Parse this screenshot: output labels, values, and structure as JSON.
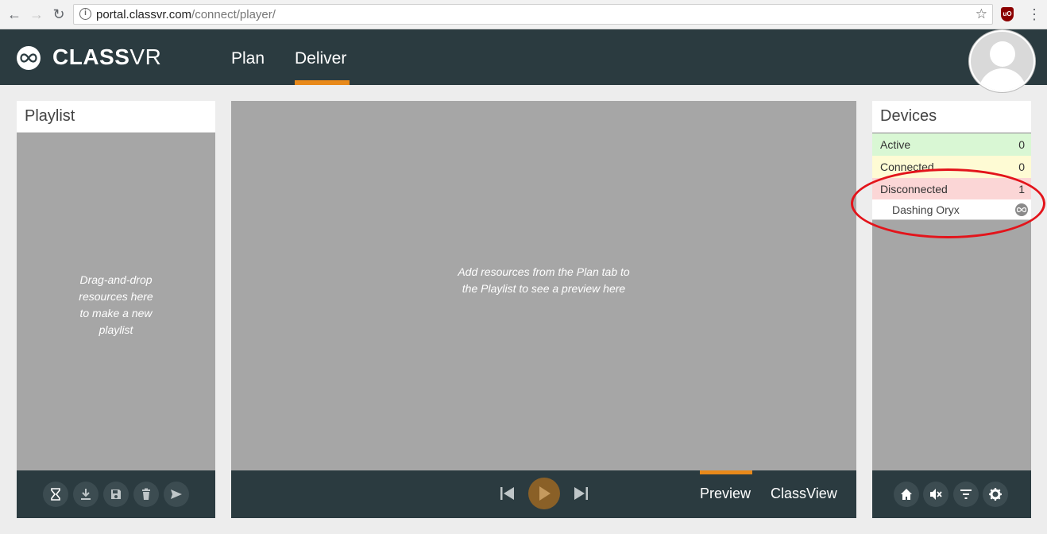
{
  "browser": {
    "url_host": "portal.classvr.com",
    "url_path": "/connect/player/",
    "back_icon": "arrow-left-icon",
    "forward_icon": "arrow-right-icon",
    "reload_icon": "reload-icon",
    "ext_label": "uO"
  },
  "header": {
    "brand_bold": "CLASS",
    "brand_light": "VR",
    "tabs": [
      {
        "label": "Plan"
      },
      {
        "label": "Deliver",
        "active": true
      }
    ],
    "accent_color": "#e8891a"
  },
  "playlist": {
    "title": "Playlist",
    "placeholder_lines": [
      "Drag-and-drop",
      "resources here",
      "to make a new",
      "playlist"
    ],
    "toolbar_icons": [
      "hourglass-icon",
      "download-icon",
      "save-icon",
      "trash-icon",
      "send-icon"
    ]
  },
  "preview": {
    "placeholder_lines": [
      "Add resources from the Plan tab to",
      "the Playlist to see a preview here"
    ],
    "view_tabs": [
      {
        "label": "Preview",
        "active": true
      },
      {
        "label": "ClassView"
      }
    ]
  },
  "devices": {
    "title": "Devices",
    "groups": [
      {
        "label": "Active",
        "count": "0",
        "color": "#d9f7d4"
      },
      {
        "label": "Connected",
        "count": "0",
        "color": "#fefbd4"
      },
      {
        "label": "Disconnected",
        "count": "1",
        "color": "#fbd6d6"
      }
    ],
    "items": [
      {
        "name": "Dashing Oryx"
      }
    ],
    "toolbar_icons": [
      "home-icon",
      "mute-icon",
      "filter-icon",
      "settings-icon"
    ]
  }
}
